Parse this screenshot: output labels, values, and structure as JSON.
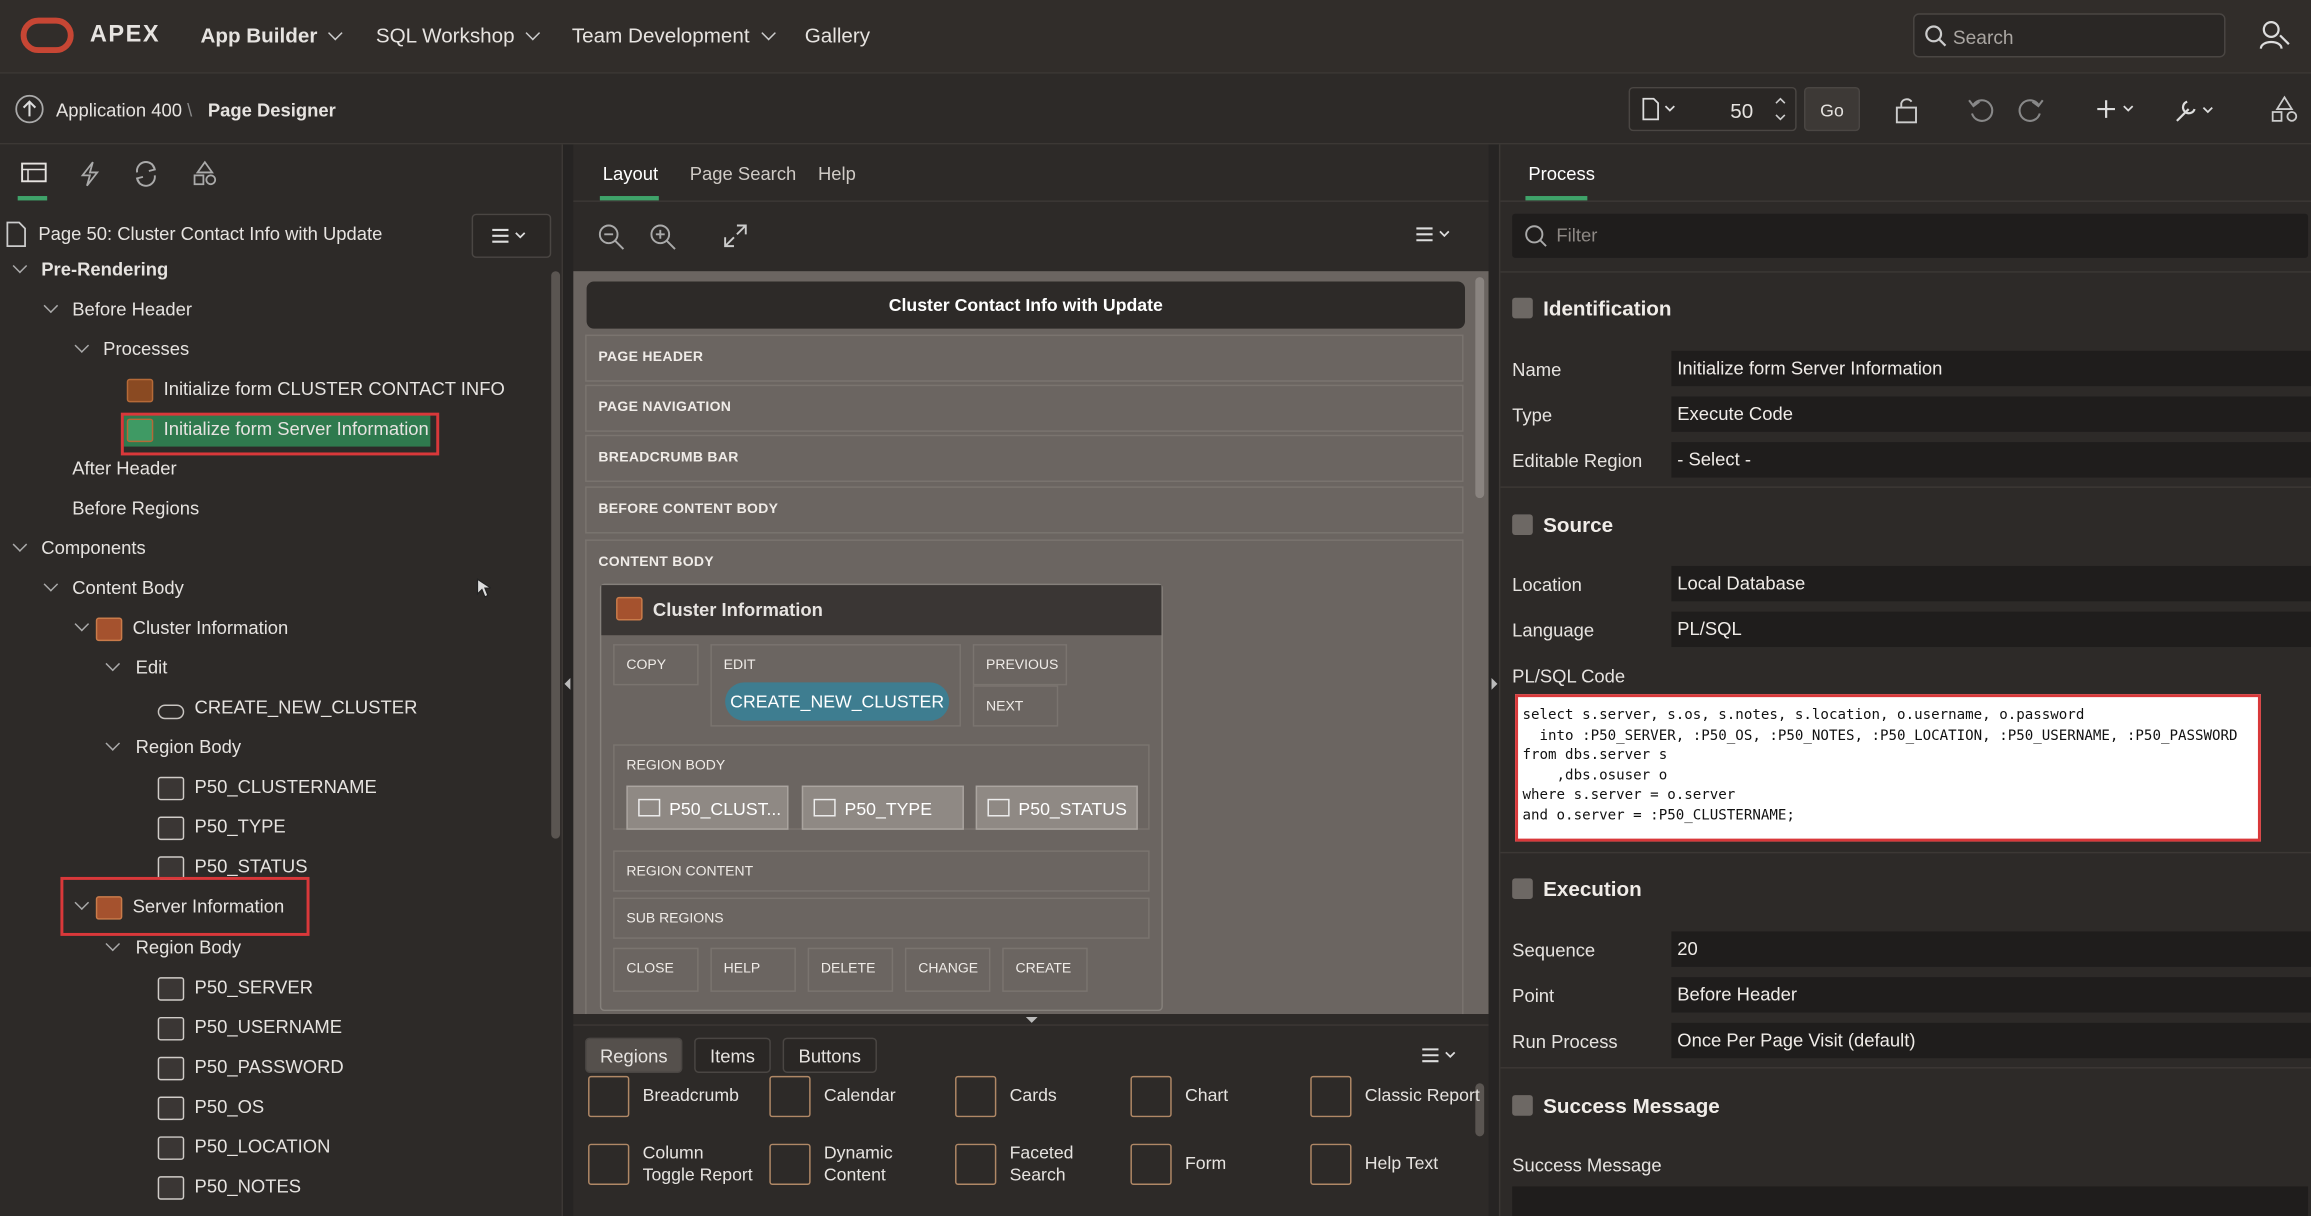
{
  "topnav": {
    "brand": "APEX",
    "items": [
      "App Builder",
      "SQL Workshop",
      "Team Development",
      "Gallery"
    ],
    "search_placeholder": "Search"
  },
  "toolbar": {
    "breadcrumb_app": "Application 400",
    "breadcrumb_page": "Page Designer",
    "page_number": "50",
    "go_label": "Go"
  },
  "left": {
    "page_title": "Page 50: Cluster Contact Info with Update",
    "tree": [
      {
        "label": "Pre-Rendering"
      },
      {
        "label": "Before Header"
      },
      {
        "label": "Processes"
      },
      {
        "label": "Initialize form CLUSTER CONTACT INFO"
      },
      {
        "label": "Initialize form Server Information"
      },
      {
        "label": "After Header"
      },
      {
        "label": "Before Regions"
      },
      {
        "label": "Components"
      },
      {
        "label": "Content Body"
      },
      {
        "label": "Cluster Information"
      },
      {
        "label": "Edit"
      },
      {
        "label": "CREATE_NEW_CLUSTER"
      },
      {
        "label": "Region Body"
      },
      {
        "label": "P50_CLUSTERNAME"
      },
      {
        "label": "P50_TYPE"
      },
      {
        "label": "P50_STATUS"
      },
      {
        "label": "Server Information"
      },
      {
        "label": "Region Body"
      },
      {
        "label": "P50_SERVER"
      },
      {
        "label": "P50_USERNAME"
      },
      {
        "label": "P50_PASSWORD"
      },
      {
        "label": "P50_OS"
      },
      {
        "label": "P50_LOCATION"
      },
      {
        "label": "P50_NOTES"
      }
    ]
  },
  "center": {
    "tabs": [
      "Layout",
      "Page Search",
      "Help"
    ],
    "page_title": "Cluster Contact Info with Update",
    "slots": [
      "PAGE HEADER",
      "PAGE NAVIGATION",
      "BREADCRUMB BAR",
      "BEFORE CONTENT BODY",
      "CONTENT BODY"
    ],
    "region": {
      "title": "Cluster Information",
      "copy": "COPY",
      "edit": "EDIT",
      "previous": "PREVIOUS",
      "next": "NEXT",
      "create_btn": "CREATE_NEW_CLUSTER",
      "region_body": "REGION BODY",
      "items": [
        "P50_CLUST...",
        "P50_TYPE",
        "P50_STATUS"
      ],
      "region_content": "REGION CONTENT",
      "sub_regions": "SUB REGIONS",
      "bottom": [
        "CLOSE",
        "HELP",
        "DELETE",
        "CHANGE",
        "CREATE"
      ]
    },
    "gallery_tabs": [
      "Regions",
      "Items",
      "Buttons"
    ],
    "gallery": [
      [
        "Breadcrumb",
        ""
      ],
      [
        "Calendar",
        ""
      ],
      [
        "Cards",
        ""
      ],
      [
        "Chart",
        ""
      ],
      [
        "Classic Report",
        ""
      ],
      [
        "Column",
        "Toggle Report"
      ],
      [
        "Dynamic",
        "Content"
      ],
      [
        "Faceted",
        "Search"
      ],
      [
        "Form",
        ""
      ],
      [
        "Help Text",
        ""
      ]
    ]
  },
  "right": {
    "tab": "Process",
    "filter_placeholder": "Filter",
    "identification": {
      "heading": "Identification",
      "name_label": "Name",
      "name": "Initialize form Server Information",
      "type_label": "Type",
      "type": "Execute Code",
      "editable_label": "Editable Region",
      "editable": "- Select -"
    },
    "source": {
      "heading": "Source",
      "location_label": "Location",
      "location": "Local Database",
      "language_label": "Language",
      "language": "PL/SQL",
      "code_label": "PL/SQL Code",
      "code": "select s.server, s.os, s.notes, s.location, o.username, o.password\n  into :P50_SERVER, :P50_OS, :P50_NOTES, :P50_LOCATION, :P50_USERNAME, :P50_PASSWORD\nfrom dbs.server s\n    ,dbs.osuser o\nwhere s.server = o.server\nand o.server = :P50_CLUSTERNAME;"
    },
    "execution": {
      "heading": "Execution",
      "sequence_label": "Sequence",
      "sequence": "20",
      "point_label": "Point",
      "point": "Before Header",
      "run_label": "Run Process",
      "run": "Once Per Page Visit (default)"
    },
    "success": {
      "heading": "Success Message",
      "label": "Success Message"
    }
  }
}
